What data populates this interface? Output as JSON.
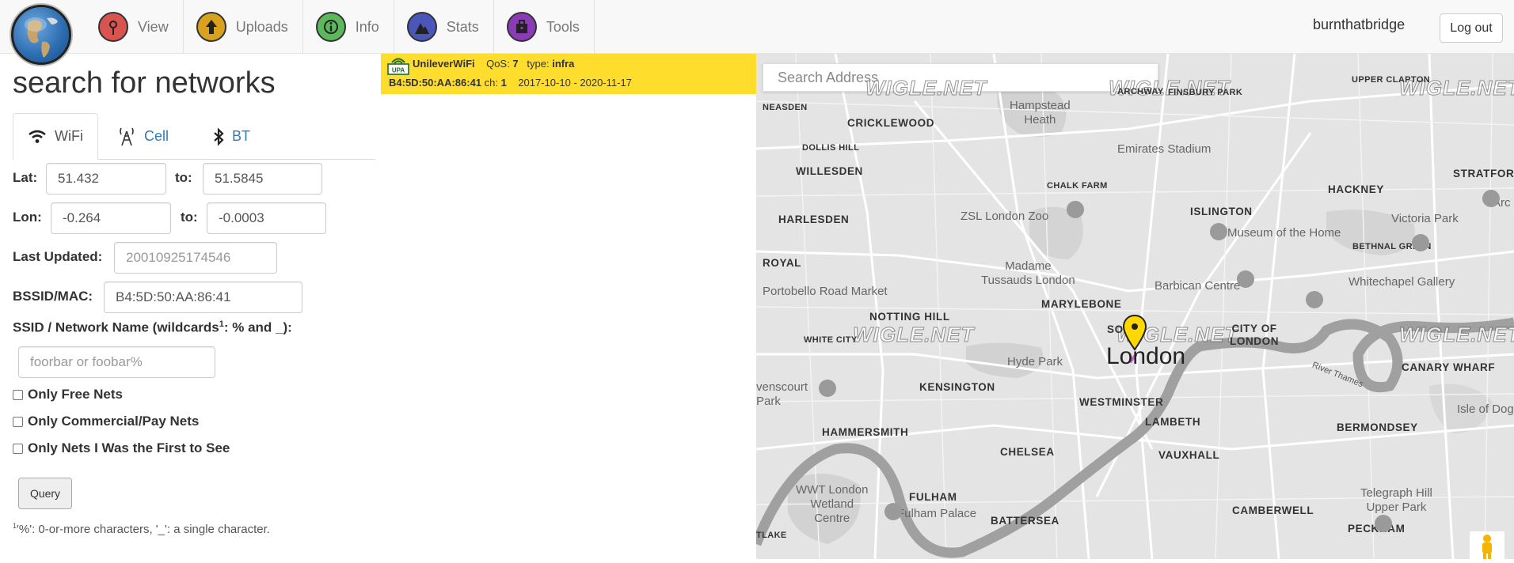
{
  "nav": {
    "items": [
      {
        "label": "View",
        "icon": "radio-tower-icon",
        "color": "#d9534f"
      },
      {
        "label": "Uploads",
        "icon": "upload-arrow-icon",
        "color": "#d8a21f"
      },
      {
        "label": "Info",
        "icon": "info-icon",
        "color": "#5cb85c"
      },
      {
        "label": "Stats",
        "icon": "stats-mountain-icon",
        "color": "#4a57b8"
      },
      {
        "label": "Tools",
        "icon": "toolbox-icon",
        "color": "#8b3bb5"
      }
    ],
    "username": "burnthatbridge",
    "logout_label": "Log out"
  },
  "form": {
    "title": "search for networks",
    "tabs": [
      {
        "label": "WiFi",
        "icon": "wifi-icon",
        "active": true
      },
      {
        "label": "Cell",
        "icon": "cell-tower-icon",
        "active": false
      },
      {
        "label": "BT",
        "icon": "bluetooth-icon",
        "active": false
      }
    ],
    "lat_label": "Lat:",
    "lat_from": "51.432",
    "to_label": "to:",
    "lat_to": "51.5845",
    "lon_label": "Lon:",
    "lon_from": "-0.264",
    "lon_to": "-0.0003",
    "last_updated_label": "Last Updated:",
    "last_updated_placeholder": "20010925174546",
    "bssid_label": "BSSID/MAC:",
    "bssid_value": "B4:5D:50:AA:86:41",
    "ssid_label": "SSID / Network Name (wildcards",
    "ssid_label_sup": "1",
    "ssid_label_tail": ": % and _):",
    "ssid_placeholder": "foorbar or foobar%",
    "checkboxes": [
      "Only Free Nets",
      "Only Commercial/Pay Nets",
      "Only Nets I Was the First to See"
    ],
    "query_label": "Query",
    "footnote_sup": "1",
    "footnote_text": "'%': 0-or-more characters, '_': a single character."
  },
  "result": {
    "ssid": "UnileverWiFi",
    "qos_label": "QoS:",
    "qos": "7",
    "type_label": "type:",
    "type": "infra",
    "bssid": "B4:5D:50:AA:86:41",
    "ch_label": "ch:",
    "channel": "1",
    "date_range": "2017-10-10 - 2020-11-17",
    "badge_text": "UPA",
    "color": "#ffdd2c"
  },
  "map": {
    "search_placeholder": "Search Address",
    "watermark": "WIGLE.NET",
    "labels": {
      "neasden": "NEASDEN",
      "cricklewood": "CRICKLEWOOD",
      "dollis_hill": "DOLLIS HILL",
      "willesden": "WILLESDEN",
      "harlesden": "HARLESDEN",
      "royal": "ROYAL",
      "notting_hill": "NOTTING HILL",
      "white_city": "WHITE CITY",
      "kensington": "KENSINGTON",
      "hammersmith": "HAMMERSMITH",
      "chelsea": "CHELSEA",
      "fulham": "FULHAM",
      "battersea": "BATTERSEA",
      "marylebone": "MARYLEBONE",
      "soho": "SOHO",
      "city_of_london": "CITY OF\nLONDON",
      "westminster": "WESTMINSTER",
      "lambeth": "LAMBETH",
      "vauxhall": "VAUXHALL",
      "camberwell": "CAMBERWELL",
      "peckham": "PECKHAM",
      "bermondsey": "BERMONDSEY",
      "canary_wharf": "CANARY WHARF",
      "hackney": "HACKNEY",
      "islington": "ISLINGTON",
      "stratford": "STRATFOR",
      "bethnal_green": "BETHNAL GREEN",
      "upper_clapton": "UPPER CLAPTON",
      "finsbury_park": "FINSBURY PARK",
      "archway": "ARCHWAY",
      "chalk_farm": "CHALK FARM",
      "lake": "TLAKE",
      "london": "London",
      "hampstead_heath": "Hampstead\nHeath",
      "emirates": "Emirates Stadium",
      "zsl": "ZSL London Zoo",
      "madame": "Madame\nTussauds London",
      "portobello": "Portobello Road Market",
      "barbican": "Barbican Centre",
      "museum_home": "Museum of the Home",
      "victoria_park": "Victoria Park",
      "whitechapel": "Whitechapel Gallery",
      "hyde_park": "Hyde Park",
      "wwt": "WWT London\nWetland\nCentre",
      "fulham_palace": "Fulham Palace",
      "telegraph_hill": "Telegraph Hill\nUpper Park",
      "isle_dogs": "Isle of Dogs",
      "ravenscourt": "venscourt\nPark",
      "river_thames": "River Thames",
      "arc": "Arc"
    }
  }
}
